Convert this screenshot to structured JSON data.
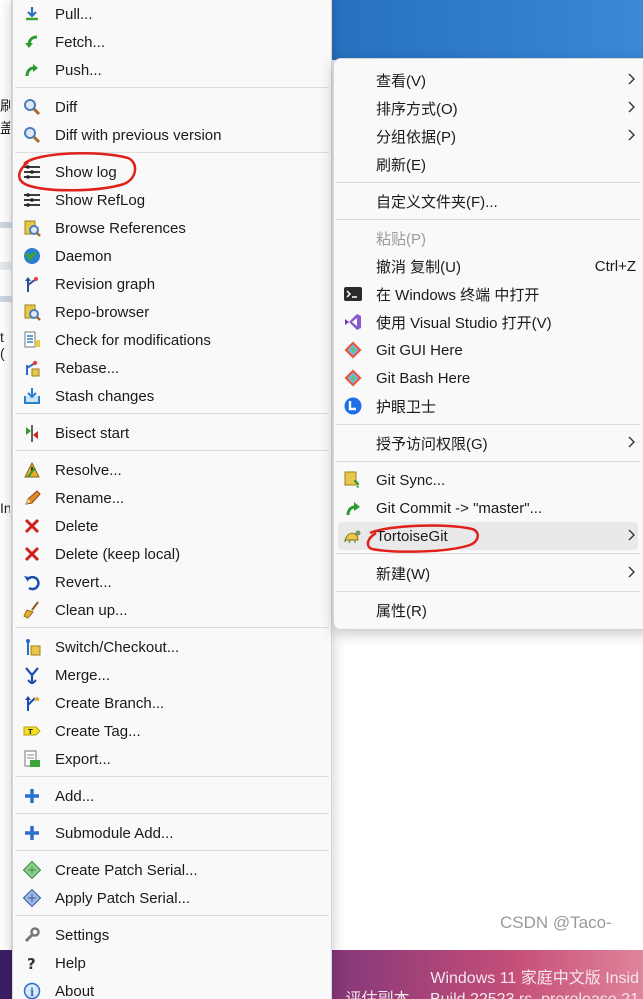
{
  "desktop": {
    "left_chars": [
      "刷",
      "盖",
      "t (",
      "In"
    ],
    "watermark_line1": "Windows 11 家庭中文版 Insid",
    "watermark_line2": "评估副本。 Build 22523.rs_prerelease.21",
    "csdn": "CSDN @Taco-"
  },
  "tortoise_menu": {
    "items": [
      {
        "label": "Pull...",
        "icon": "pull-icon"
      },
      {
        "label": "Fetch...",
        "icon": "fetch-icon"
      },
      {
        "label": "Push...",
        "icon": "push-icon"
      },
      {
        "label": "Diff",
        "icon": "diff-icon"
      },
      {
        "label": "Diff with previous version",
        "icon": "diff-previous-icon"
      },
      {
        "label": "Show log",
        "icon": "show-log-icon"
      },
      {
        "label": "Show RefLog",
        "icon": "show-reflog-icon"
      },
      {
        "label": "Browse References",
        "icon": "browse-references-icon"
      },
      {
        "label": "Daemon",
        "icon": "daemon-globe-icon"
      },
      {
        "label": "Revision graph",
        "icon": "revision-graph-icon"
      },
      {
        "label": "Repo-browser",
        "icon": "repo-browser-icon"
      },
      {
        "label": "Check for modifications",
        "icon": "check-modifications-icon"
      },
      {
        "label": "Rebase...",
        "icon": "rebase-icon"
      },
      {
        "label": "Stash changes",
        "icon": "stash-icon"
      },
      {
        "label": "Bisect start",
        "icon": "bisect-icon"
      },
      {
        "label": "Resolve...",
        "icon": "resolve-icon"
      },
      {
        "label": "Rename...",
        "icon": "rename-pencil-icon"
      },
      {
        "label": "Delete",
        "icon": "delete-x-icon"
      },
      {
        "label": "Delete (keep local)",
        "icon": "delete-keep-local-x-icon"
      },
      {
        "label": "Revert...",
        "icon": "revert-icon"
      },
      {
        "label": "Clean up...",
        "icon": "cleanup-broom-icon"
      },
      {
        "label": "Switch/Checkout...",
        "icon": "switch-checkout-icon"
      },
      {
        "label": "Merge...",
        "icon": "merge-icon"
      },
      {
        "label": "Create Branch...",
        "icon": "create-branch-icon"
      },
      {
        "label": "Create Tag...",
        "icon": "create-tag-icon"
      },
      {
        "label": "Export...",
        "icon": "export-icon"
      },
      {
        "label": "Add...",
        "icon": "add-plus-icon"
      },
      {
        "label": "Submodule Add...",
        "icon": "submodule-add-plus-icon"
      },
      {
        "label": "Create Patch Serial...",
        "icon": "create-patch-icon"
      },
      {
        "label": "Apply Patch Serial...",
        "icon": "apply-patch-icon"
      },
      {
        "label": "Settings",
        "icon": "settings-wrench-icon"
      },
      {
        "label": "Help",
        "icon": "help-question-icon"
      },
      {
        "label": "About",
        "icon": "about-info-icon"
      }
    ]
  },
  "context_menu": {
    "items": [
      {
        "label": "查看(V)"
      },
      {
        "label": "排序方式(O)"
      },
      {
        "label": "分组依据(P)"
      },
      {
        "label": "刷新(E)"
      },
      {
        "label": "自定义文件夹(F)..."
      },
      {
        "label": "粘贴(P)"
      },
      {
        "label": "撤消 复制(U)",
        "shortcut": "Ctrl+Z"
      },
      {
        "label": "在 Windows 终端 中打开",
        "icon": "terminal-icon"
      },
      {
        "label": "使用 Visual Studio 打开(V)",
        "icon": "visual-studio-icon"
      },
      {
        "label": "Git GUI Here",
        "icon": "git-gui-icon"
      },
      {
        "label": "Git Bash Here",
        "icon": "git-bash-icon"
      },
      {
        "label": "护眼卫士",
        "icon": "eye-guard-icon"
      },
      {
        "label": "授予访问权限(G)"
      },
      {
        "label": "Git Sync...",
        "icon": "git-sync-icon"
      },
      {
        "label": "Git Commit -> \"master\"...",
        "icon": "git-commit-icon"
      },
      {
        "label": "TortoiseGit",
        "icon": "tortoisegit-icon"
      },
      {
        "label": "新建(W)"
      },
      {
        "label": "属性(R)"
      }
    ]
  },
  "colors": {
    "accent_blue": "#2a74c4",
    "annotation_red": "#e0201a",
    "menu_bg": "#f9f9f9"
  }
}
